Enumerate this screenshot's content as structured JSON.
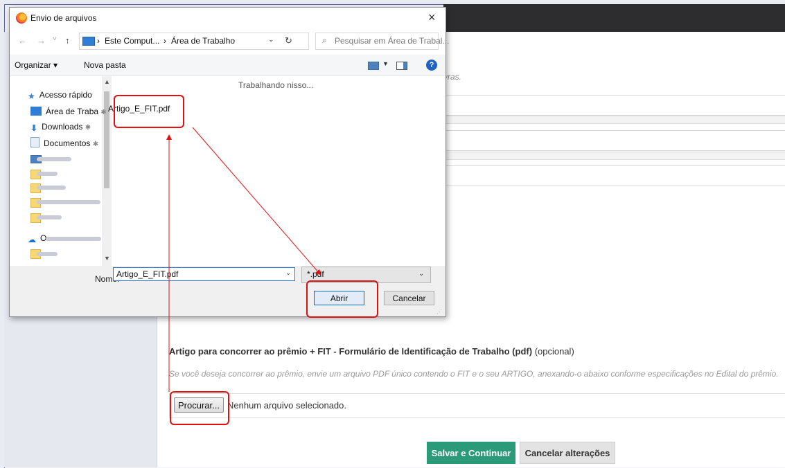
{
  "page": {
    "hint_text": "vras.",
    "artigo": {
      "title": "Artigo para concorrer ao prêmio + FIT - Formulário de Identificação de Trabalho (pdf)",
      "optional": "(opcional)",
      "description": "Se você deseja concorrer ao prêmio, envie um arquivo PDF único contendo o FIT e o seu ARTIGO, anexando-o abaixo conforme especificações no Edital do prêmio.",
      "browse_label": "Procurar...",
      "no_file_text": "Nenhum arquivo selecionado."
    },
    "actions": {
      "save_label": "Salvar e Continuar",
      "cancel_label": "Cancelar alterações"
    }
  },
  "dialog": {
    "title": "Envio de arquivos",
    "close": "×",
    "nav": {
      "back": "←",
      "forward": "→",
      "recent": "˅",
      "up": "↑",
      "breadcrumb": [
        "Este Comput...",
        "Área de Trabalho"
      ],
      "separator": "›",
      "dropdown": "⌄",
      "refresh": "↻"
    },
    "search_placeholder": "Pesquisar em Área de Trabal...",
    "toolbar": {
      "organize": "Organizar ▾",
      "new_folder": "Nova pasta",
      "help": "?"
    },
    "sidebar": {
      "quick_access": "Acesso rápido",
      "items": [
        {
          "label": "Área de Traba"
        },
        {
          "label": "Downloads"
        },
        {
          "label": "Documentos"
        }
      ],
      "onedrive": "O"
    },
    "status": "Trabalhando nisso...",
    "files": [
      "Artigo_E_FIT.pdf"
    ],
    "filename_label": "Nome:",
    "filename_value": "Artigo_E_FIT.pdf",
    "filter_value": "*.pdf",
    "open_label": "Abrir",
    "cancel_label": "Cancelar"
  },
  "colors": {
    "accent_green": "#2a9a79",
    "annotation_red": "#e01010",
    "topbar_dark": "#2d2d2f"
  }
}
